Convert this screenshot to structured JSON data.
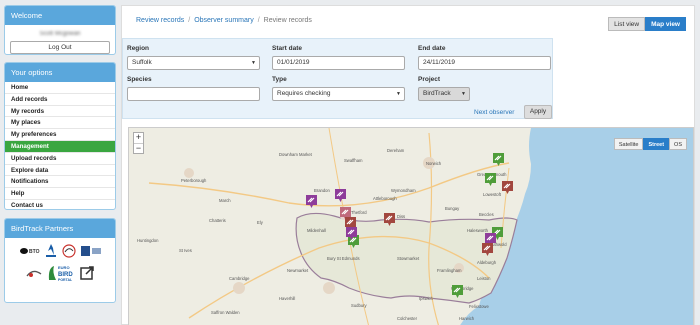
{
  "welcome": {
    "title": "Welcome",
    "user": "Scott Mcgowan",
    "logout": "Log Out"
  },
  "options": {
    "title": "Your options",
    "items": [
      "Home",
      "Add records",
      "My records",
      "My places",
      "My preferences",
      "Management",
      "Upload records",
      "Explore data",
      "Notifications",
      "Help",
      "Contact us"
    ],
    "active": "Management"
  },
  "partners": {
    "title": "BirdTrack Partners",
    "logos": [
      "BTO",
      "RSPB",
      "BirdWatch Ireland",
      "SOC",
      "WOS",
      "EuroBird Portal"
    ]
  },
  "breadcrumb": [
    "Review records",
    "Observer summary",
    "Review records"
  ],
  "view": {
    "list": "List view",
    "map": "Map view",
    "active": "Map view"
  },
  "filters": {
    "region_label": "Region",
    "region": "Suffolk",
    "start_label": "Start date",
    "start": "01/01/2019",
    "end_label": "End date",
    "end": "24/11/2019",
    "species_label": "Species",
    "species": "",
    "type_label": "Type",
    "type": "Requires checking",
    "project_label": "Project",
    "project": "BirdTrack",
    "next": "Next observer",
    "apply": "Apply"
  },
  "map": {
    "zoom_in": "+",
    "zoom_out": "−",
    "types": [
      "Satellite",
      "Street",
      "OS"
    ],
    "active_type": "Street",
    "places": [
      "Peterborough",
      "Downham Market",
      "Swaffham",
      "Dereham",
      "Norwich",
      "Great Yarmouth",
      "Lowestoft",
      "Thetford",
      "Diss",
      "Bungay",
      "Beccles",
      "Halesworth",
      "Bury St Edmunds",
      "Stowmarket",
      "Framlingham",
      "Aldeburgh",
      "Woodbridge",
      "Ipswich",
      "Cambridge",
      "Newmarket",
      "Mildenhall",
      "Brandon",
      "Haverhill",
      "Sudbury",
      "Saffron Walden",
      "Wymondham",
      "Attleborough",
      "Huntingdon",
      "St Ives",
      "Ely",
      "Chatteris",
      "March",
      "Southwold",
      "Leiston",
      "Felixstowe",
      "Harwich",
      "Colchester",
      "Stowmarket"
    ],
    "marker_colors": {
      "purple": "#8e3c9a",
      "green": "#4f9d3a",
      "red": "#a2473f",
      "pink": "#c06a7c"
    }
  }
}
